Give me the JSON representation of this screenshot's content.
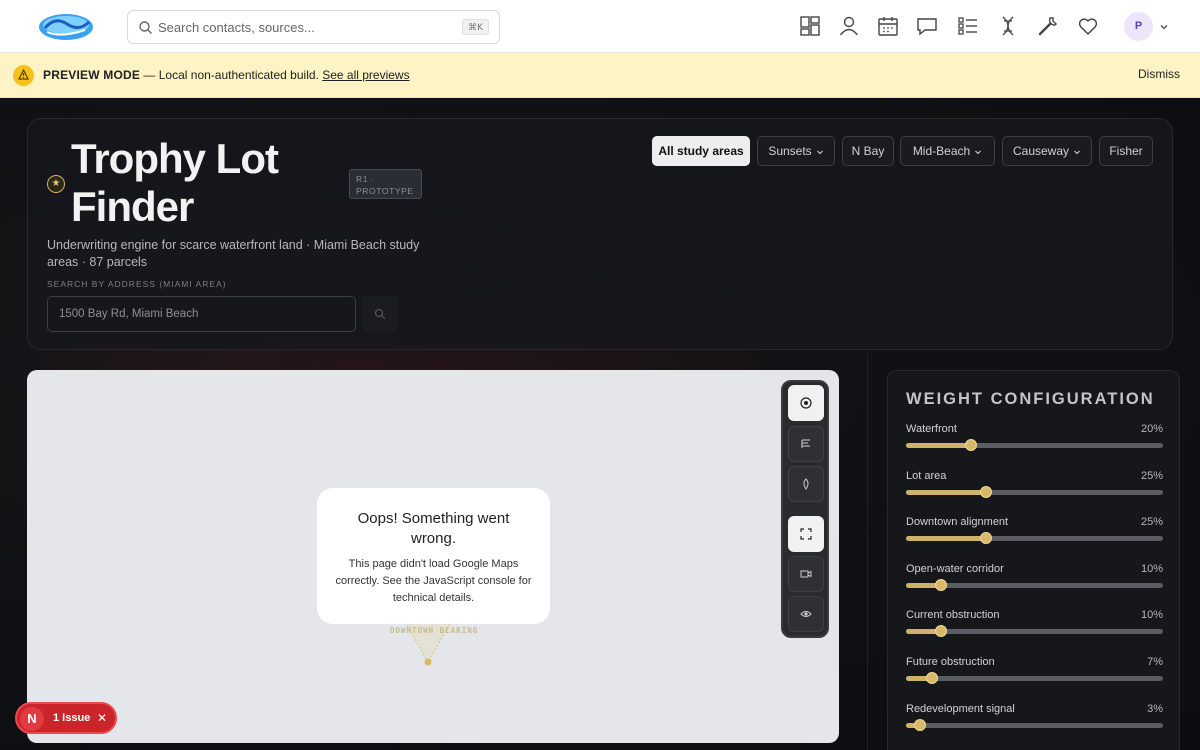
{
  "nav": {
    "search_placeholder": "Search contacts, sources...",
    "search_shortcut": "⌘K",
    "icons": [
      "layout-grid-icon",
      "user-icon",
      "calendar-icon",
      "chat-icon",
      "list-icon",
      "dna-icon",
      "wrench-icon",
      "heart-icon"
    ],
    "avatar_initial": "P"
  },
  "banner": {
    "label": "PREVIEW MODE",
    "text": " — Local non-authenticated build. ",
    "link": "See all previews",
    "dismiss": "Dismiss"
  },
  "header": {
    "title": "Trophy Lot Finder",
    "badge": "R1 · PROTOTYPE",
    "subtitle": "Underwriting engine for scarce waterfront land · Miami Beach study areas · 87 parcels",
    "address_label": "SEARCH BY ADDRESS (MIAMI AREA)",
    "address_placeholder": "1500 Bay Rd, Miami Beach"
  },
  "filters": [
    {
      "label": "All study areas",
      "active": true,
      "dropdown": false
    },
    {
      "label": "Sunsets",
      "active": false,
      "dropdown": true
    },
    {
      "label": "N Bay",
      "active": false,
      "dropdown": false
    },
    {
      "label": "Mid-Beach",
      "active": false,
      "dropdown": true
    },
    {
      "label": "Causeway",
      "active": false,
      "dropdown": true
    },
    {
      "label": "Fisher",
      "active": false,
      "dropdown": false
    }
  ],
  "map": {
    "error_title": "Oops! Something went wrong.",
    "error_body": "This page didn't load Google Maps correctly. See the JavaScript console for technical details.",
    "bearing_label": "DOWNTOWN BEARING"
  },
  "weights": {
    "title": "WEIGHT CONFIGURATION",
    "items": [
      {
        "label": "Waterfront",
        "value": 20,
        "display": "20%"
      },
      {
        "label": "Lot area",
        "value": 25,
        "display": "25%"
      },
      {
        "label": "Downtown alignment",
        "value": 25,
        "display": "25%"
      },
      {
        "label": "Open-water corridor",
        "value": 10,
        "display": "10%"
      },
      {
        "label": "Current obstruction",
        "value": 10,
        "display": "10%"
      },
      {
        "label": "Future obstruction",
        "value": 7,
        "display": "7%"
      },
      {
        "label": "Redevelopment signal",
        "value": 3,
        "display": "3%"
      }
    ]
  },
  "issue": {
    "badge": "N",
    "text": "1 Issue"
  },
  "colors": {
    "accent_gold": "#cfb26a",
    "banner_bg": "#fdf3c4",
    "issue_red": "#c9252b"
  }
}
